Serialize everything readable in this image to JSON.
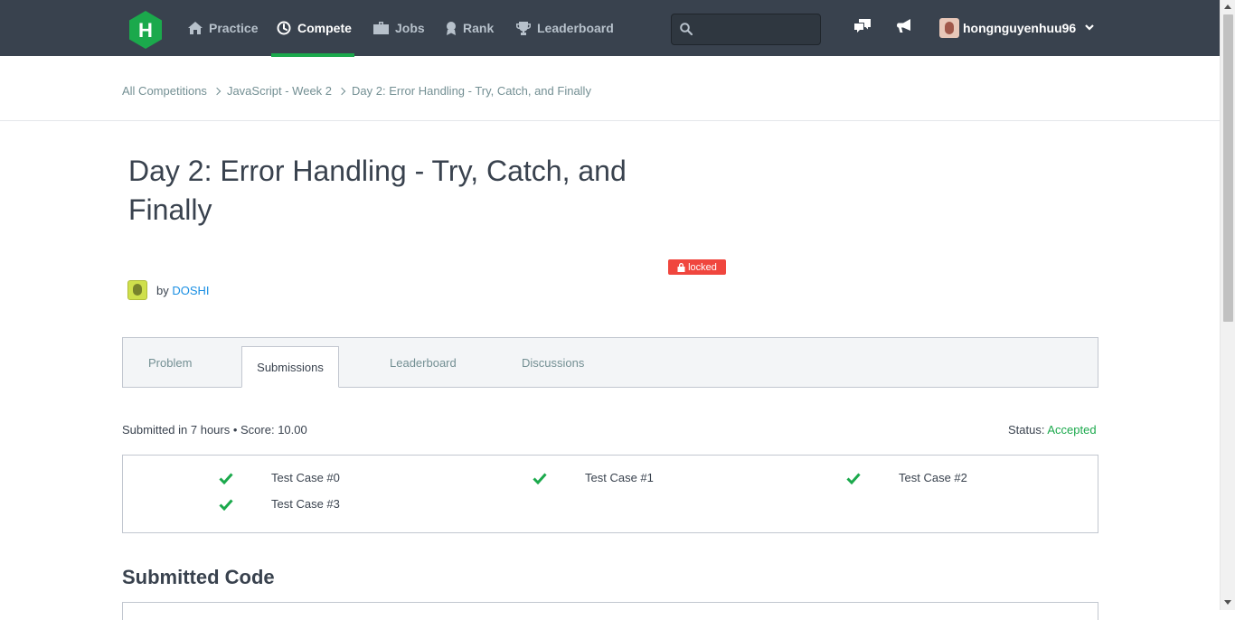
{
  "nav": {
    "logo_letter": "H",
    "items": [
      {
        "label": "Practice",
        "icon": "home-icon"
      },
      {
        "label": "Compete",
        "icon": "clock-icon"
      },
      {
        "label": "Jobs",
        "icon": "briefcase-icon"
      },
      {
        "label": "Rank",
        "icon": "rank-icon"
      },
      {
        "label": "Leaderboard",
        "icon": "trophy-icon"
      }
    ],
    "active": "Compete",
    "search_placeholder": "",
    "username": "hongnguyenhuu96",
    "colors": {
      "bg": "#39424e",
      "accent": "#1ba94c"
    }
  },
  "breadcrumb": [
    "All Competitions",
    "JavaScript - Week 2",
    "Day 2: Error Handling - Try, Catch, and Finally"
  ],
  "challenge": {
    "title": "Day 2: Error Handling - Try, Catch, and Finally",
    "locked_label": "locked",
    "by_label": "by",
    "author": "DOSHI"
  },
  "tabs": [
    {
      "label": "Problem"
    },
    {
      "label": "Submissions"
    },
    {
      "label": "Leaderboard"
    },
    {
      "label": "Discussions"
    }
  ],
  "active_tab": "Submissions",
  "submission": {
    "summary": "Submitted in 7 hours • Score: 10.00",
    "status_label": "Status:",
    "status_value": "Accepted",
    "test_cases": [
      "Test Case #0",
      "Test Case #1",
      "Test Case #2",
      "Test Case #3"
    ],
    "code_heading": "Submitted Code"
  }
}
